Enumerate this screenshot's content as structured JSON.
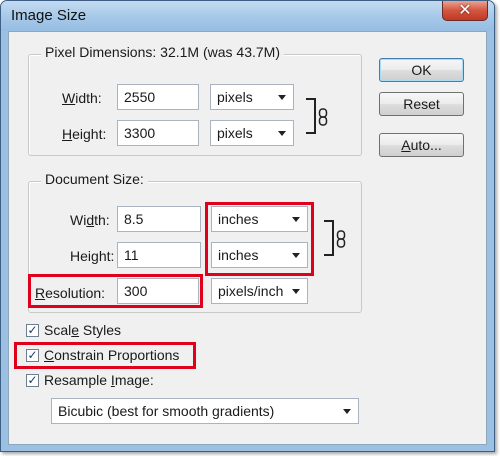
{
  "window": {
    "title": "Image Size",
    "close_glyph": "✕"
  },
  "pixel_dimensions": {
    "legend_label": "Pixel Dimensions:",
    "legend_value": "32.1M (was 43.7M)",
    "width_label_mnemonic": "W",
    "width_label_rest": "idth:",
    "width_value": "2550",
    "width_unit": "pixels",
    "height_label_mnemonic": "H",
    "height_label_rest": "eight:",
    "height_value": "3300",
    "height_unit": "pixels"
  },
  "document_size": {
    "legend": "Document Size:",
    "width_label_pre": "Wi",
    "width_label_mnemonic": "d",
    "width_label_rest": "th:",
    "width_value": "8.5",
    "width_unit": "inches",
    "height_label_pre": "Hei",
    "height_label_mnemonic": "g",
    "height_label_rest": "ht:",
    "height_value": "11",
    "height_unit": "inches",
    "resolution_label_mnemonic": "R",
    "resolution_label_rest": "esolution:",
    "resolution_value": "300",
    "resolution_unit": "pixels/inch"
  },
  "buttons": {
    "ok": "OK",
    "reset": "Reset",
    "auto_mnemonic": "A",
    "auto_rest": "uto..."
  },
  "options": {
    "check_glyph": "✓",
    "scale_styles_pre": "Scal",
    "scale_styles_mnemonic": "e",
    "scale_styles_rest": " Styles",
    "scale_styles_checked": true,
    "constrain_mnemonic": "C",
    "constrain_rest": "onstrain Proportions",
    "constrain_checked": true,
    "resample_pre": "Resample ",
    "resample_mnemonic": "I",
    "resample_rest": "mage:",
    "resample_checked": true,
    "resample_method": "Bicubic (best for smooth gradients)"
  },
  "highlight_color": "#e0001b"
}
